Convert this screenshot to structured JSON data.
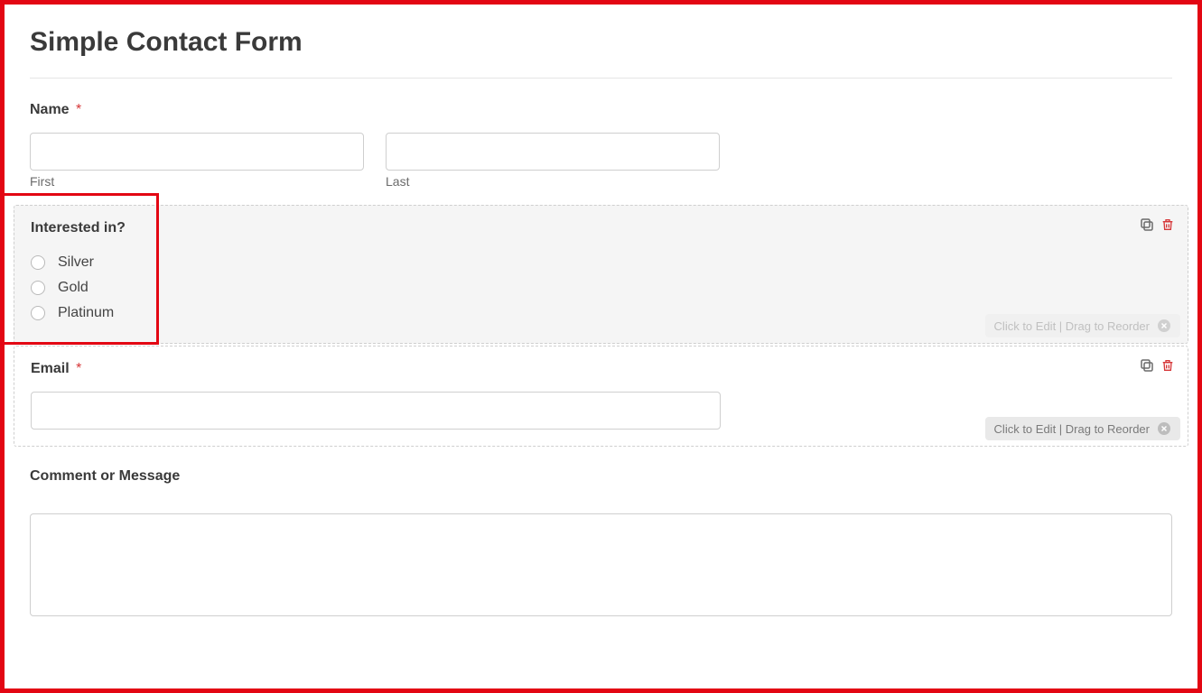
{
  "form": {
    "title": "Simple Contact Form",
    "name": {
      "label": "Name",
      "required": "*",
      "first_sublabel": "First",
      "last_sublabel": "Last"
    },
    "interested": {
      "label": "Interested in?",
      "options": {
        "opt1": "Silver",
        "opt2": "Gold",
        "opt3": "Platinum"
      }
    },
    "email": {
      "label": "Email",
      "required": "*"
    },
    "comment": {
      "label": "Comment or Message"
    },
    "editor": {
      "hint_faded": "Click to Edit | Drag to Reorder",
      "hint_visible": "Click to Edit | Drag to Reorder"
    }
  }
}
